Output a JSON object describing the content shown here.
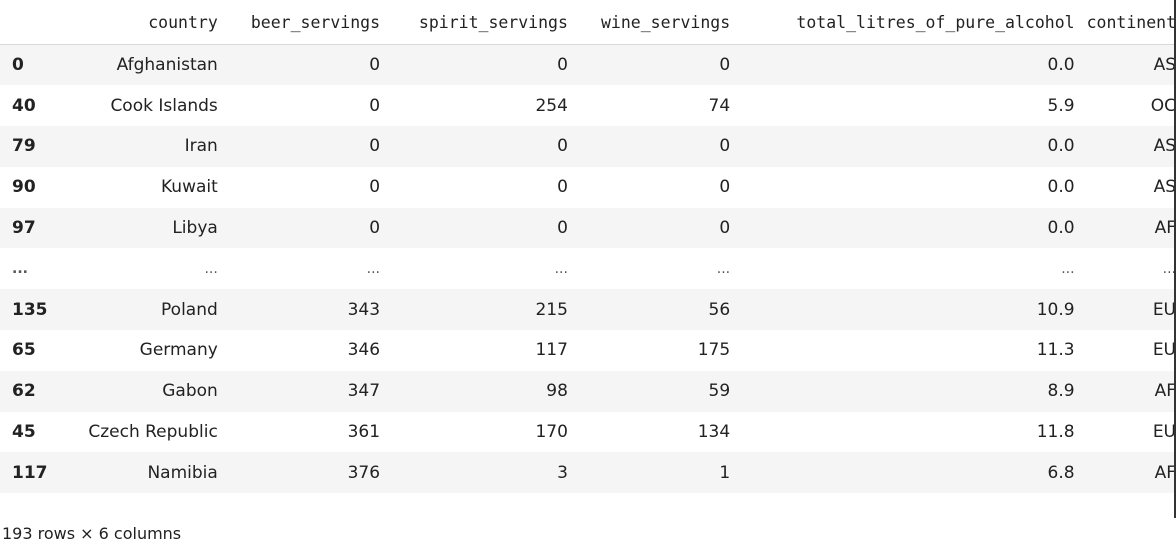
{
  "columns": [
    "",
    "country",
    "beer_servings",
    "spirit_servings",
    "wine_servings",
    "total_litres_of_pure_alcohol",
    "continent"
  ],
  "rows": [
    {
      "idx": "0",
      "country": "Afghanistan",
      "beer": "0",
      "spirit": "0",
      "wine": "0",
      "alcohol": "0.0",
      "continent": "AS"
    },
    {
      "idx": "40",
      "country": "Cook Islands",
      "beer": "0",
      "spirit": "254",
      "wine": "74",
      "alcohol": "5.9",
      "continent": "OC"
    },
    {
      "idx": "79",
      "country": "Iran",
      "beer": "0",
      "spirit": "0",
      "wine": "0",
      "alcohol": "0.0",
      "continent": "AS"
    },
    {
      "idx": "90",
      "country": "Kuwait",
      "beer": "0",
      "spirit": "0",
      "wine": "0",
      "alcohol": "0.0",
      "continent": "AS"
    },
    {
      "idx": "97",
      "country": "Libya",
      "beer": "0",
      "spirit": "0",
      "wine": "0",
      "alcohol": "0.0",
      "continent": "AF"
    },
    {
      "idx": "...",
      "country": "...",
      "beer": "...",
      "spirit": "...",
      "wine": "...",
      "alcohol": "...",
      "continent": "..."
    },
    {
      "idx": "135",
      "country": "Poland",
      "beer": "343",
      "spirit": "215",
      "wine": "56",
      "alcohol": "10.9",
      "continent": "EU"
    },
    {
      "idx": "65",
      "country": "Germany",
      "beer": "346",
      "spirit": "117",
      "wine": "175",
      "alcohol": "11.3",
      "continent": "EU"
    },
    {
      "idx": "62",
      "country": "Gabon",
      "beer": "347",
      "spirit": "98",
      "wine": "59",
      "alcohol": "8.9",
      "continent": "AF"
    },
    {
      "idx": "45",
      "country": "Czech Republic",
      "beer": "361",
      "spirit": "170",
      "wine": "134",
      "alcohol": "11.8",
      "continent": "EU"
    },
    {
      "idx": "117",
      "country": "Namibia",
      "beer": "376",
      "spirit": "3",
      "wine": "1",
      "alcohol": "6.8",
      "continent": "AF"
    }
  ],
  "footer": "193 rows × 6 columns"
}
